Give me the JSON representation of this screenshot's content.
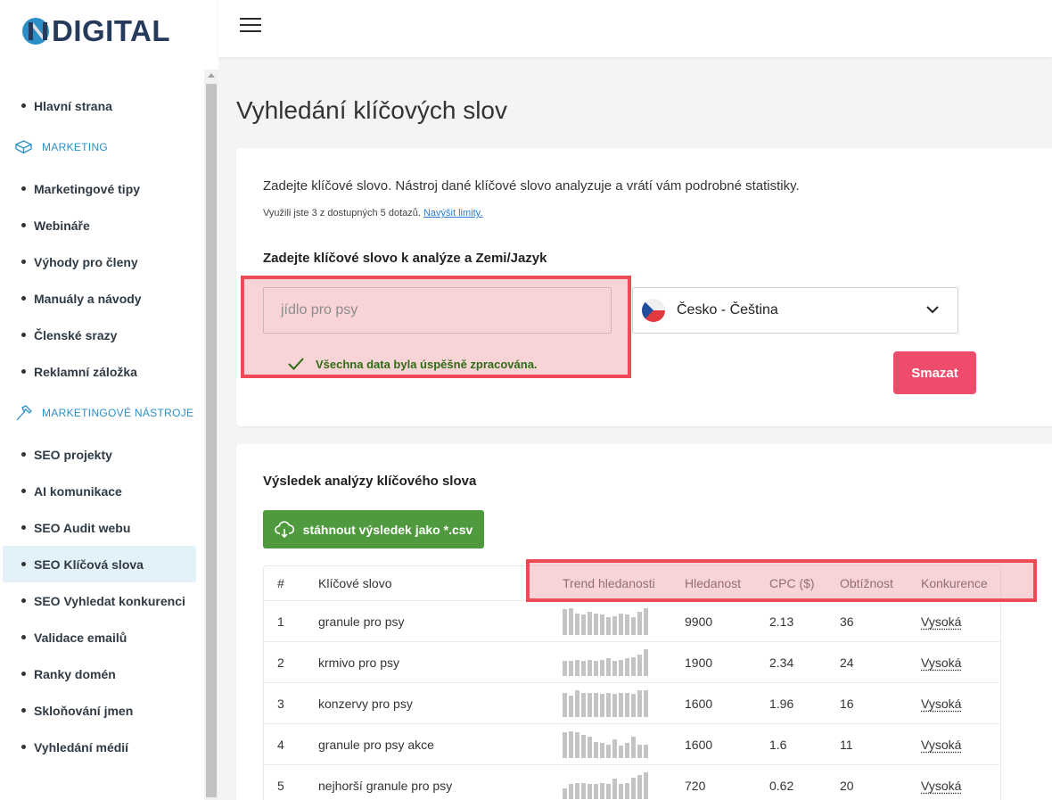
{
  "brand": {
    "logo_text": "DIGITAL"
  },
  "sidebar": {
    "items": [
      {
        "type": "item",
        "label": "Hlavní strana"
      },
      {
        "type": "section",
        "label": "MARKETING",
        "icon": "box-icon"
      },
      {
        "type": "item",
        "label": "Marketingové tipy"
      },
      {
        "type": "item",
        "label": "Webináře"
      },
      {
        "type": "item",
        "label": "Výhody pro členy"
      },
      {
        "type": "item",
        "label": "Manuály a návody"
      },
      {
        "type": "item",
        "label": "Členské srazy"
      },
      {
        "type": "item",
        "label": "Reklamní záložka"
      },
      {
        "type": "section",
        "label": "MARKETINGOVÉ NÁSTROJE",
        "icon": "hammer-icon"
      },
      {
        "type": "item",
        "label": "SEO projekty"
      },
      {
        "type": "item",
        "label": "AI komunikace"
      },
      {
        "type": "item",
        "label": "SEO Audit webu"
      },
      {
        "type": "item",
        "label": "SEO Klíčová slova",
        "active": true
      },
      {
        "type": "item",
        "label": "SEO Vyhledat konkurenci"
      },
      {
        "type": "item",
        "label": "Validace emailů"
      },
      {
        "type": "item",
        "label": "Ranky domén"
      },
      {
        "type": "item",
        "label": "Skloňování jmen"
      },
      {
        "type": "item",
        "label": "Vyhledání médií"
      }
    ]
  },
  "page": {
    "title": "Vyhledání klíčových slov"
  },
  "search_card": {
    "intro": "Zadejte klíčové slovo. Nástroj dané klíčové slovo analyzuje a vrátí vám podrobné statistiky.",
    "quota_text": "Využili jste 3 z dostupných 5 dotazů.",
    "quota_link": "Navýšit limity.",
    "form_label": "Zadejte klíčové slovo k analýze a Zemi/Jazyk",
    "keyword_placeholder": "jídlo pro psy",
    "success_message": "Všechna data byla úspěšně zpracována.",
    "language_selected": "Česko - Čeština",
    "delete_label": "Smazat"
  },
  "results": {
    "title": "Výsledek analýzy klíčového slova",
    "csv_button": "stáhnout výsledek jako *.csv",
    "columns": [
      "#",
      "Klíčové slovo",
      "Trend hledanosti",
      "Hledanost",
      "CPC ($)",
      "Obtížnost",
      "Konkurence"
    ],
    "rows": [
      {
        "num": "1",
        "keyword": "granule pro psy",
        "trend": [
          0.95,
          1.0,
          0.8,
          0.75,
          0.85,
          0.8,
          0.75,
          0.65,
          0.7,
          0.8,
          0.75,
          0.65,
          0.85,
          1.0
        ],
        "volume": "9900",
        "cpc": "2.13",
        "difficulty": "36",
        "competition": "Vysoká"
      },
      {
        "num": "2",
        "keyword": "krmivo pro psy",
        "trend": [
          0.55,
          0.55,
          0.6,
          0.55,
          0.6,
          0.55,
          0.6,
          0.65,
          0.55,
          0.6,
          0.65,
          0.7,
          0.8,
          1.0
        ],
        "volume": "1900",
        "cpc": "2.34",
        "difficulty": "24",
        "competition": "Vysoká"
      },
      {
        "num": "3",
        "keyword": "konzervy pro psy",
        "trend": [
          0.9,
          0.8,
          1.0,
          0.9,
          0.9,
          0.9,
          0.85,
          0.9,
          0.85,
          0.9,
          0.9,
          0.85,
          1.0,
          1.0
        ],
        "volume": "1600",
        "cpc": "1.96",
        "difficulty": "16",
        "competition": "Vysoká"
      },
      {
        "num": "4",
        "keyword": "granule pro psy akce",
        "trend": [
          0.95,
          1.0,
          0.95,
          0.85,
          0.8,
          0.6,
          0.55,
          0.5,
          0.7,
          0.45,
          0.55,
          0.8,
          0.5,
          0.5
        ],
        "volume": "1600",
        "cpc": "1.6",
        "difficulty": "11",
        "competition": "Vysoká"
      },
      {
        "num": "5",
        "keyword": "nejhorší granule pro psy",
        "trend": [
          0.4,
          0.55,
          0.6,
          0.6,
          0.55,
          0.55,
          0.6,
          0.55,
          0.75,
          0.55,
          0.6,
          0.8,
          0.9,
          1.0
        ],
        "volume": "720",
        "cpc": "0.62",
        "difficulty": "20",
        "competition": "Vysoká"
      }
    ]
  },
  "colors": {
    "accent": "#2a8fc7",
    "delete": "#ef4b6c",
    "csv": "#4f9a3e",
    "highlight_border": "#ef4a55",
    "success": "#2e6b14"
  }
}
